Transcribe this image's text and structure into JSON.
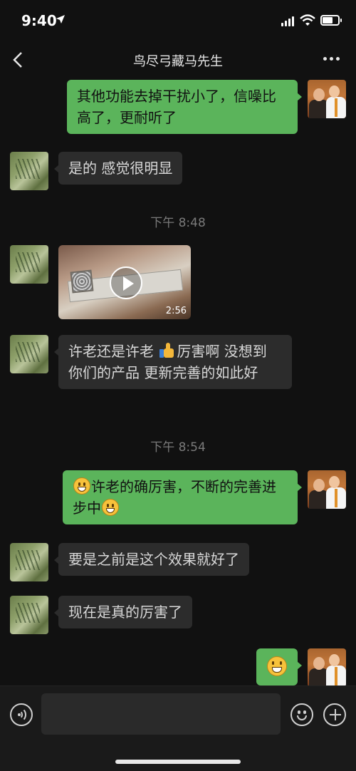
{
  "status_bar": {
    "time": "9:40"
  },
  "nav": {
    "title": "鸟尽弓藏马先生"
  },
  "messages": {
    "m1": "其他功能去掉干扰小了，信噪比高了，更耐听了",
    "m2": "是的  感觉很明显",
    "ts1": "下午 8:48",
    "video_duration": "2:56",
    "m4_a": "许老还是许老 ",
    "m4_b": "厉害啊  没想到 你们的产品 更新完善的如此好",
    "ts2": "下午 8:54",
    "m5_a": "许老的确厉害，不断的完善进步中",
    "m6": "要是之前是这个效果就好了",
    "m7": "现在是真的厉害了"
  },
  "icons": {
    "back": "chevron-left-icon",
    "more": "more-dots-icon",
    "voice": "voice-icon",
    "emoji": "emoji-icon",
    "plus": "plus-icon"
  },
  "colors": {
    "sent_bubble": "#5bb45b",
    "recv_bubble": "#2c2c2c",
    "background": "#111111"
  }
}
